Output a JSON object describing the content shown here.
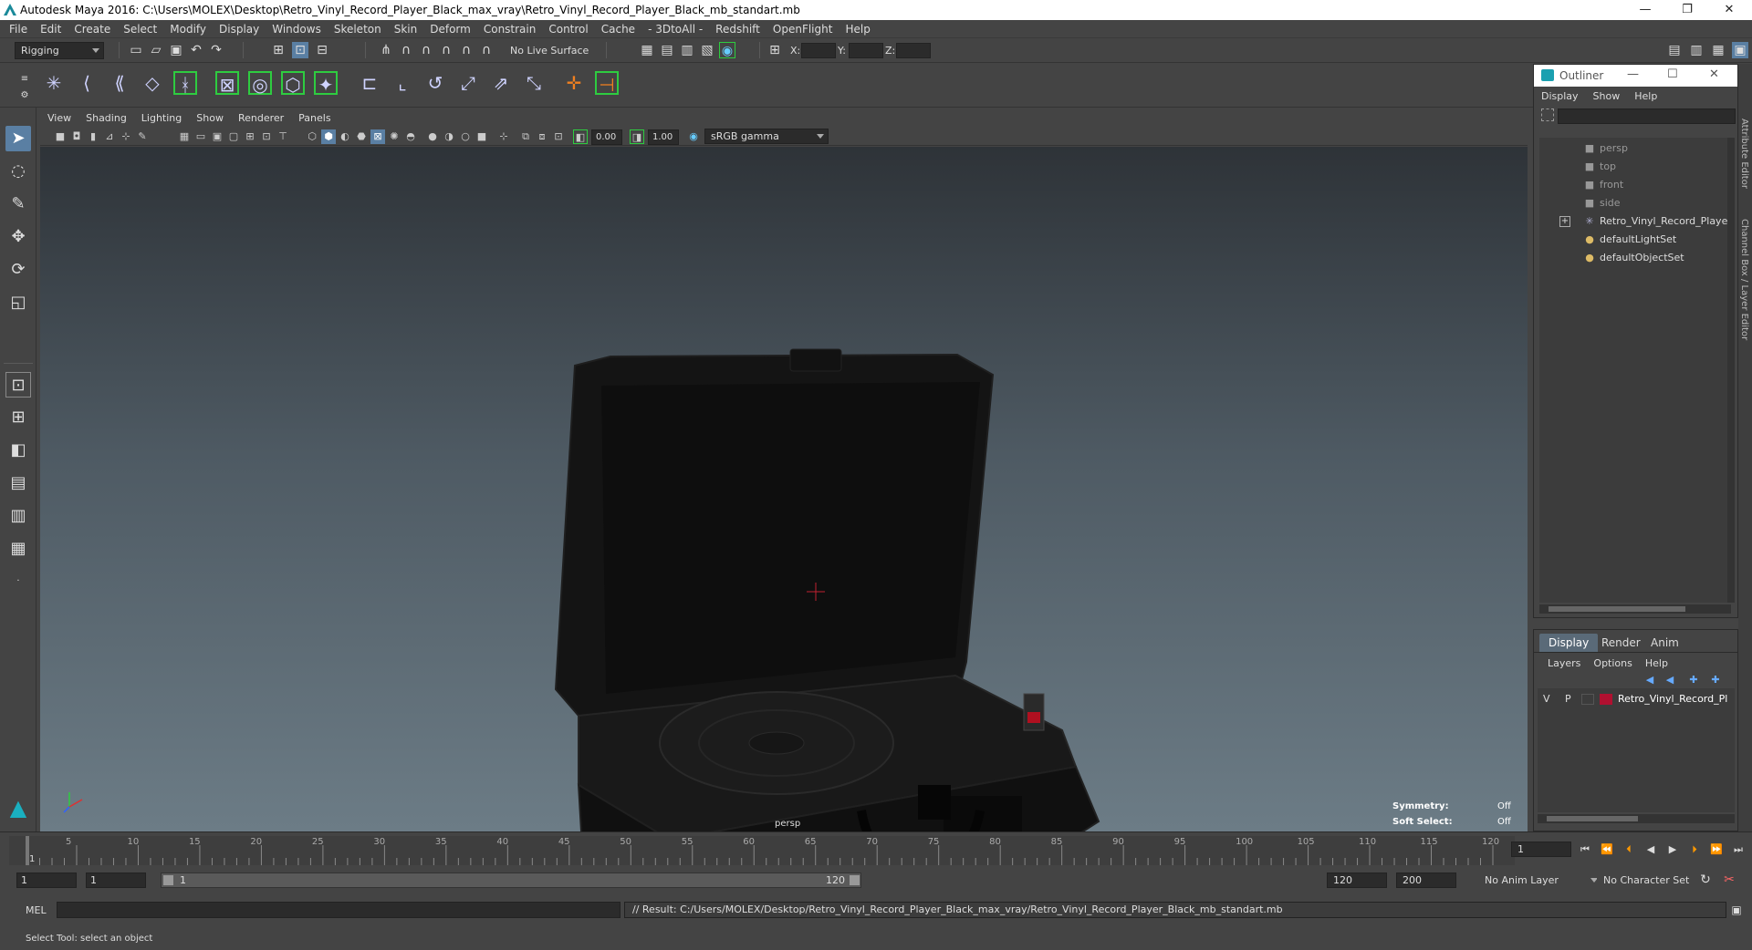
{
  "window": {
    "title": "Autodesk Maya 2016: C:\\Users\\MOLEX\\Desktop\\Retro_Vinyl_Record_Player_Black_max_vray\\Retro_Vinyl_Record_Player_Black_mb_standart.mb",
    "min": "—",
    "max": "❐",
    "close": "✕"
  },
  "menubar": [
    "File",
    "Edit",
    "Create",
    "Select",
    "Modify",
    "Display",
    "Windows",
    "Skeleton",
    "Skin",
    "Deform",
    "Constrain",
    "Control",
    "Cache",
    "- 3DtoAll -",
    "Redshift",
    "OpenFlight",
    "Help"
  ],
  "status_line": {
    "menuset": "Rigging",
    "live_surface": "No Live Surface",
    "x_label": "X:",
    "y_label": "Y:",
    "z_label": "Z:"
  },
  "viewport": {
    "menu": [
      "View",
      "Shading",
      "Lighting",
      "Show",
      "Renderer",
      "Panels"
    ],
    "exposure": "0.00",
    "gamma": "1.00",
    "color_space": "sRGB gamma",
    "camera_label": "persp",
    "symmetry_label": "Symmetry:",
    "symmetry_value": "Off",
    "soft_select_label": "Soft Select:",
    "soft_select_value": "Off"
  },
  "outliner": {
    "title": "Outliner",
    "menu": [
      "Display",
      "Show",
      "Help"
    ],
    "items": [
      {
        "label": "persp",
        "icon": "camera-icon"
      },
      {
        "label": "top",
        "icon": "camera-icon"
      },
      {
        "label": "front",
        "icon": "camera-icon"
      },
      {
        "label": "side",
        "icon": "camera-icon"
      },
      {
        "label": "Retro_Vinyl_Record_Player_B",
        "icon": "transform-icon",
        "expand": "+"
      },
      {
        "label": "defaultLightSet",
        "icon": "set-icon"
      },
      {
        "label": "defaultObjectSet",
        "icon": "set-icon"
      }
    ]
  },
  "side_tabs": [
    "Attribute Editor",
    "Channel Box / Layer Editor"
  ],
  "layer_editor": {
    "tabs": [
      "Display",
      "Render",
      "Anim"
    ],
    "menu": [
      "Layers",
      "Options",
      "Help"
    ],
    "layer": {
      "v": "V",
      "p": "P",
      "name": "Retro_Vinyl_Record_Pl",
      "color": "#b01030"
    }
  },
  "timeline": {
    "ticks": [
      "5",
      "10",
      "15",
      "20",
      "25",
      "30",
      "35",
      "40",
      "45",
      "50",
      "55",
      "60",
      "65",
      "70",
      "75",
      "80",
      "85",
      "90",
      "95",
      "100",
      "105",
      "110",
      "115",
      "120"
    ],
    "start_tick": "1",
    "current_frame": "1"
  },
  "range": {
    "start": "1",
    "playback_start": "1",
    "slider_start": "1",
    "slider_end": "120",
    "playback_end": "120",
    "end": "200",
    "anim_layer": "No Anim Layer",
    "character_set": "No Character Set"
  },
  "command_line": {
    "lang": "MEL",
    "result": "// Result: C:/Users/MOLEX/Desktop/Retro_Vinyl_Record_Player_Black_max_vray/Retro_Vinyl_Record_Player_Black_mb_standart.mb"
  },
  "help_line": "Select Tool: select an object"
}
